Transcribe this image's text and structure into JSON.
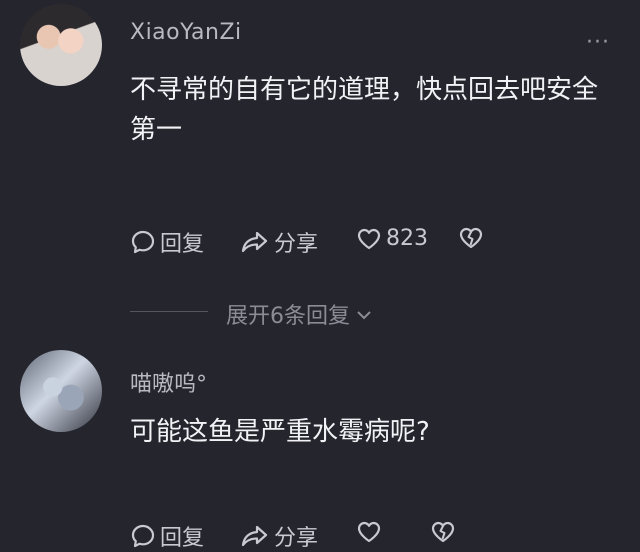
{
  "comments": [
    {
      "username": "XiaoYanZi",
      "text": "不寻常的自有它的道理，快点回去吧安全第一",
      "more_label": "···",
      "actions": {
        "reply_label": "回复",
        "share_label": "分享",
        "like_count": "823"
      },
      "expand_label": "展开6条回复"
    },
    {
      "username": "喵嗷呜°",
      "text": "可能这鱼是严重水霉病呢?",
      "actions": {
        "reply_label": "回复",
        "share_label": "分享"
      }
    }
  ],
  "icons": {
    "reply": "comment-bubble-icon",
    "share": "share-arrow-icon",
    "like": "heart-icon",
    "dislike": "broken-heart-icon",
    "expand": "chevron-down-icon"
  },
  "colors": {
    "background": "#25252e",
    "text_primary": "#f2f2f6",
    "text_secondary": "#b9b9c2"
  }
}
